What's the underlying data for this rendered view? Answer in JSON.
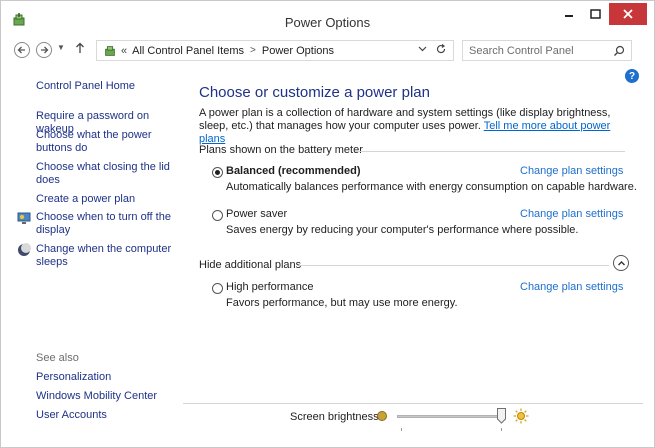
{
  "window": {
    "title": "Power Options"
  },
  "address_bar": {
    "separator": "«",
    "crumbs": [
      "All Control Panel Items",
      "Power Options"
    ],
    "crumb_separator": ">"
  },
  "search": {
    "placeholder": "Search Control Panel"
  },
  "sidebar": {
    "home": "Control Panel Home",
    "items": [
      "Require a password on wakeup",
      "Choose what the power buttons do",
      "Choose what closing the lid does",
      "Create a power plan",
      "Choose when to turn off the display",
      "Change when the computer sleeps"
    ],
    "see_also_label": "See also",
    "see_also": [
      "Personalization",
      "Windows Mobility Center",
      "User Accounts"
    ]
  },
  "main": {
    "heading": "Choose or customize a power plan",
    "description": "A power plan is a collection of hardware and system settings (like display brightness, sleep, etc.) that manages how your computer uses power.",
    "description_link": "Tell me more about power plans",
    "group_battery": "Plans shown on the battery meter",
    "group_hidden": "Hide additional plans",
    "change_label": "Change plan settings",
    "plans": [
      {
        "name": "Balanced (recommended)",
        "desc": "Automatically balances performance with energy consumption on capable hardware.",
        "selected": true
      },
      {
        "name": "Power saver",
        "desc": "Saves energy by reducing your computer's performance where possible.",
        "selected": false
      },
      {
        "name": "High performance",
        "desc": "Favors performance, but may use more energy.",
        "selected": false
      }
    ]
  },
  "brightness": {
    "label": "Screen brightness:",
    "level_percent": 100
  },
  "colors": {
    "link": "#1e3287",
    "accent_link": "#1e6fce",
    "close_button": "#c7373a"
  },
  "icons": {
    "app": "power-options-icon",
    "back": "arrow-left-icon",
    "forward": "arrow-right-icon",
    "up": "arrow-up-icon",
    "refresh": "refresh-icon",
    "search": "magnifier-icon",
    "help": "help-icon"
  }
}
